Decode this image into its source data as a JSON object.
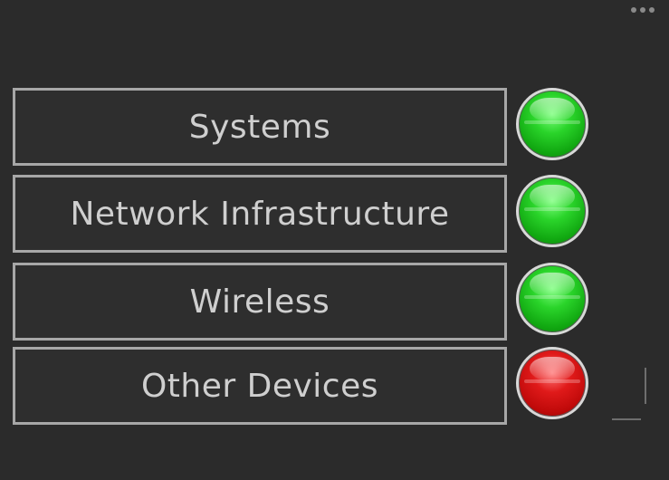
{
  "widget": {
    "menu_icon": "more-horizontal-icon"
  },
  "statuses": [
    {
      "label": "Systems",
      "status": "ok",
      "color": "#22c522"
    },
    {
      "label": "Network Infrastructure",
      "status": "ok",
      "color": "#22c522"
    },
    {
      "label": "Wireless",
      "status": "ok",
      "color": "#22c522"
    },
    {
      "label": "Other Devices",
      "status": "error",
      "color": "#d21010"
    }
  ],
  "colors": {
    "background": "#2b2b2b",
    "box_border": "#a7a7a7",
    "text": "#cfcfcf"
  }
}
